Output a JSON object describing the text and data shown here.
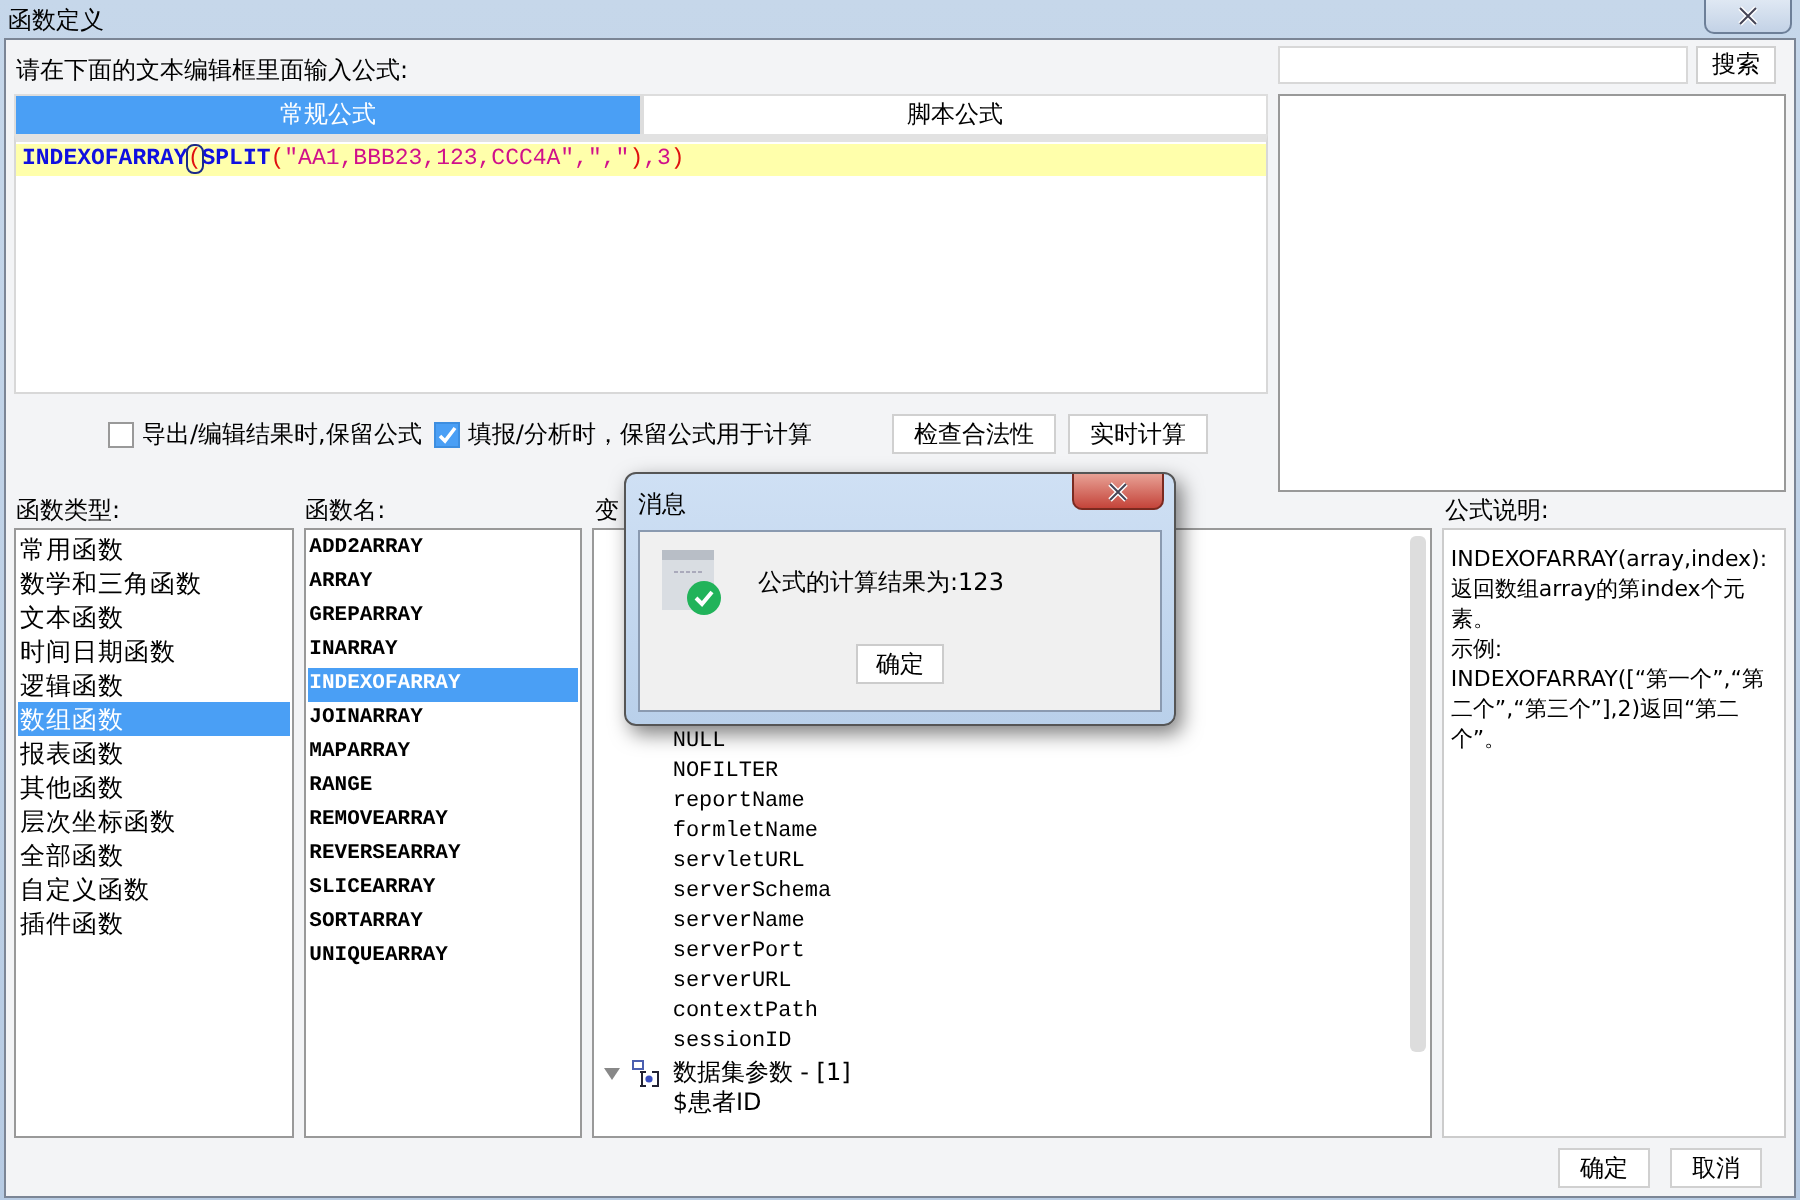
{
  "window": {
    "title": "函数定义"
  },
  "formula_prompt": "请在下面的文本编辑框里面输入公式:",
  "tabs": [
    {
      "label": "常规公式",
      "selected": true
    },
    {
      "label": "脚本公式",
      "selected": false
    }
  ],
  "formula_tokens": [
    {
      "text": "INDEXOFARRAY",
      "kind": "func"
    },
    {
      "text": "(",
      "kind": "bracket"
    },
    {
      "text": "SPLIT",
      "kind": "func"
    },
    {
      "text": "(",
      "kind": "paren"
    },
    {
      "text": "\"AA1,BBB23,123,CCC4A\",\",\"",
      "kind": "string"
    },
    {
      "text": ")",
      "kind": "paren"
    },
    {
      "text": ",3",
      "kind": "string"
    },
    {
      "text": ")",
      "kind": "paren"
    }
  ],
  "search": {
    "button": "搜索"
  },
  "options": [
    {
      "label": "导出/编辑结果时,保留公式",
      "checked": false
    },
    {
      "label": "填报/分析时，保留公式用于计算",
      "checked": true
    }
  ],
  "actions": [
    "检查合法性",
    "实时计算"
  ],
  "function_types": {
    "label": "函数类型:",
    "items": [
      {
        "label": "常用函数",
        "selected": false
      },
      {
        "label": "数学和三角函数",
        "selected": false
      },
      {
        "label": "文本函数",
        "selected": false
      },
      {
        "label": "时间日期函数",
        "selected": false
      },
      {
        "label": "逻辑函数",
        "selected": false
      },
      {
        "label": "数组函数",
        "selected": true
      },
      {
        "label": "报表函数",
        "selected": false
      },
      {
        "label": "其他函数",
        "selected": false
      },
      {
        "label": "层次坐标函数",
        "selected": false
      },
      {
        "label": "全部函数",
        "selected": false
      },
      {
        "label": "自定义函数",
        "selected": false
      },
      {
        "label": "插件函数",
        "selected": false
      }
    ]
  },
  "function_names": {
    "label": "函数名:",
    "items": [
      {
        "label": "ADD2ARRAY",
        "selected": false
      },
      {
        "label": "ARRAY",
        "selected": false
      },
      {
        "label": "GREPARRAY",
        "selected": false
      },
      {
        "label": "INARRAY",
        "selected": false
      },
      {
        "label": "INDEXOFARRAY",
        "selected": true
      },
      {
        "label": "JOINARRAY",
        "selected": false
      },
      {
        "label": "MAPARRAY",
        "selected": false
      },
      {
        "label": "RANGE",
        "selected": false
      },
      {
        "label": "REMOVEARRAY",
        "selected": false
      },
      {
        "label": "REVERSEARRAY",
        "selected": false
      },
      {
        "label": "SLICEARRAY",
        "selected": false
      },
      {
        "label": "SORTARRAY",
        "selected": false
      },
      {
        "label": "UNIQUEARRAY",
        "selected": false
      }
    ]
  },
  "variables": {
    "label": "变",
    "tree": [
      {
        "label": "NULL"
      },
      {
        "label": "NOFILTER"
      },
      {
        "label": "reportName"
      },
      {
        "label": "formletName"
      },
      {
        "label": "servletURL"
      },
      {
        "label": "serverSchema"
      },
      {
        "label": "serverName"
      },
      {
        "label": "serverPort"
      },
      {
        "label": "serverURL"
      },
      {
        "label": "contextPath"
      },
      {
        "label": "sessionID"
      },
      {
        "label": "数据集参数 - [1]",
        "expanded": true,
        "children": [
          {
            "label": "$患者ID"
          }
        ]
      }
    ]
  },
  "description": {
    "label": "公式说明:",
    "lines": [
      "INDEXOFARRAY(array,index):",
      "返回数组array的第index个元素。",
      "示例:",
      "INDEXOFARRAY([“第一个”,“第二个”,“第三个”],2)返回“第二个”。"
    ]
  },
  "buttons": [
    "确定",
    "取消"
  ],
  "message_dialog": {
    "title": "消息",
    "message": "公式的计算结果为:123",
    "button": "确定"
  }
}
